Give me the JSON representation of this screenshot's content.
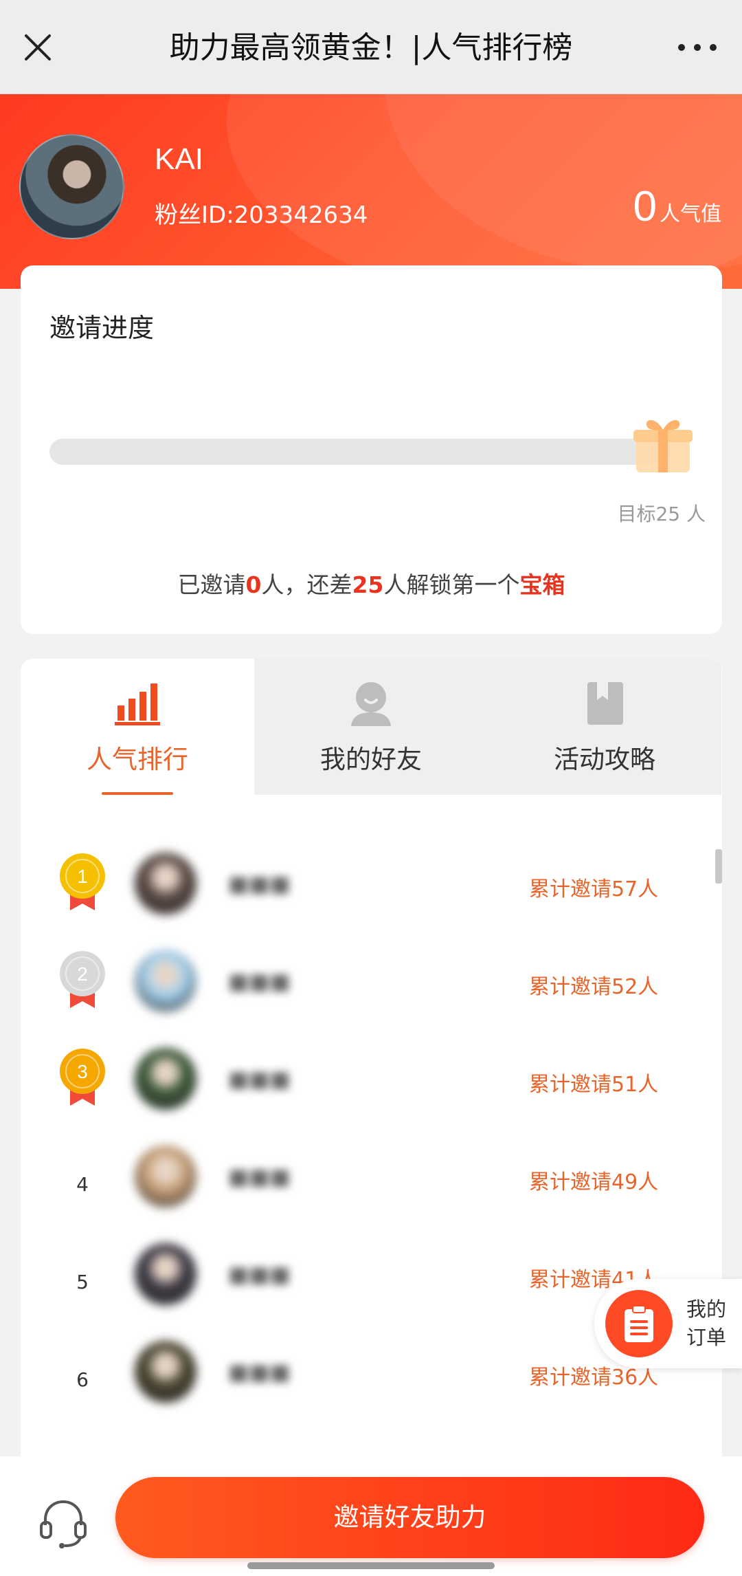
{
  "nav": {
    "title": "助力最高领黄金！|人气排行榜"
  },
  "profile": {
    "name": "KAI",
    "fan_id": "粉丝ID:203342634",
    "popularity_value": "0",
    "popularity_unit": "人气值"
  },
  "progress": {
    "title": "邀请进度",
    "target_text": "目标25 人",
    "invited": 0,
    "target": 25,
    "note": {
      "prefix": "已邀请",
      "invited": "0",
      "mid1": "人，还差",
      "remaining": "25",
      "mid2": "人解锁第一个",
      "reward": "宝箱"
    }
  },
  "tabs": [
    {
      "label": "人气排行",
      "icon": "bar-chart-icon",
      "active": true
    },
    {
      "label": "我的好友",
      "icon": "friend-icon",
      "active": false
    },
    {
      "label": "活动攻略",
      "icon": "guide-book-icon",
      "active": false
    }
  ],
  "ranking": [
    {
      "rank": "1",
      "medal": "gold",
      "count": "累计邀请57人",
      "avatar_color": "#5a4a44"
    },
    {
      "rank": "2",
      "medal": "silver",
      "count": "累计邀请52人",
      "avatar_color": "#a8d4f0"
    },
    {
      "rank": "3",
      "medal": "bronze",
      "count": "累计邀请51人",
      "avatar_color": "#3d5a3a"
    },
    {
      "rank": "4",
      "medal": "",
      "count": "累计邀请49人",
      "avatar_color": "#c9a27a"
    },
    {
      "rank": "5",
      "medal": "",
      "count": "累计邀请41人",
      "avatar_color": "#3e3a45"
    },
    {
      "rank": "6",
      "medal": "",
      "count": "累计邀请36人",
      "avatar_color": "#4a4530"
    }
  ],
  "my_orders": {
    "label": "我的订单"
  },
  "bottom": {
    "invite_button": "邀请好友助力"
  },
  "colors": {
    "brand": "#ff4a26",
    "accent_text": "#e8642a",
    "highlight": "#e8331f",
    "gold": "#f5c000",
    "silver": "#d8d8d8",
    "bronze": "#f5a700"
  }
}
